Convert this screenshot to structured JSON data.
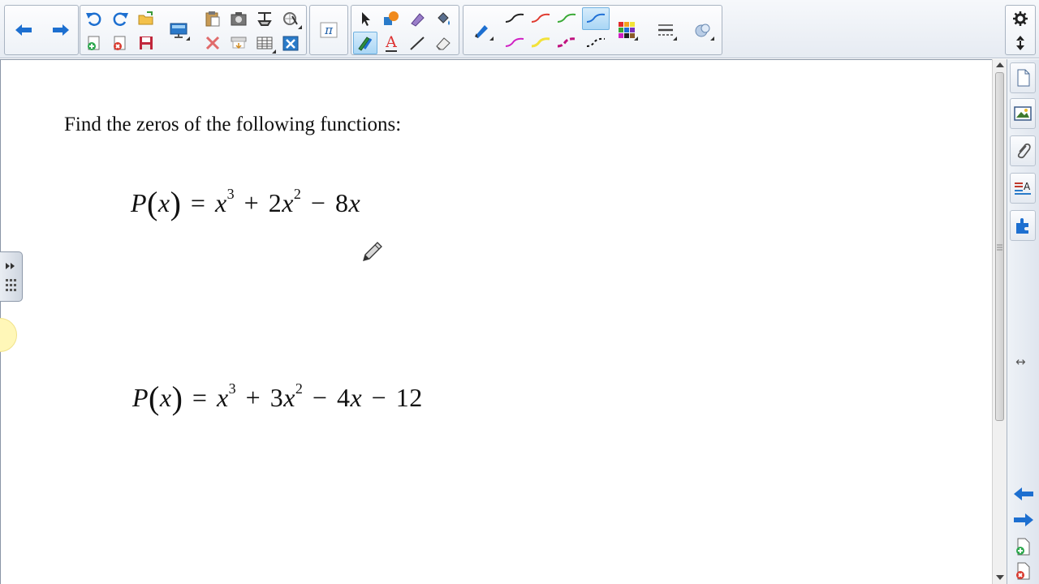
{
  "toolbar": {
    "icons": [
      "back-arrow-icon",
      "forward-arrow-icon",
      "undo-icon",
      "redo-icon",
      "open-folder-icon",
      "new-page-icon",
      "delete-page-icon",
      "save-icon",
      "screen-shade-icon",
      "paste-icon",
      "capture-icon",
      "document-camera-icon",
      "measurement-tools-icon",
      "delete-icon",
      "show-hide-icon",
      "table-icon",
      "clear-page-icon",
      "math-tools-icon",
      "select-icon",
      "shapes-icon",
      "magic-pen-icon",
      "fill-icon",
      "pen-icon",
      "creative-pen-icon",
      "text-icon",
      "line-icon",
      "eraser-icon",
      "properties-icon",
      "color-palette-icon",
      "line-style-icon",
      "more-tools-icon"
    ],
    "math_label": "π",
    "text_label": "A"
  },
  "pen_colors": {
    "black": "#222222",
    "red": "#e03a2f",
    "green": "#39a935",
    "blue": "#1f6fd6",
    "magenta": "#d01fc3",
    "yellow": "#f2e23a",
    "violet": "#c0127e",
    "dashed": "#111111"
  },
  "canvas": {
    "prompt": "Find the zeros of the following functions:",
    "eq1": {
      "lhs_fn": "P",
      "lhs_var": "x",
      "t1": "x",
      "t1_exp": "3",
      "t2_coef": "2",
      "t2": "x",
      "t2_exp": "2",
      "t3_coef": "8",
      "t3": "x"
    },
    "eq2": {
      "lhs_fn": "P",
      "lhs_var": "x",
      "t1": "x",
      "t1_exp": "3",
      "t2_coef": "3",
      "t2": "x",
      "t2_exp": "2",
      "t3_coef": "4",
      "t3": "x",
      "t4": "12"
    },
    "symbols": {
      "eq": "=",
      "plus": "+",
      "minus": "−",
      "lparen": "(",
      "rparen": ")"
    }
  },
  "sidebar": {
    "tabs": [
      "page-sorter-icon",
      "gallery-icon",
      "attachments-icon",
      "properties-tab-icon",
      "add-ons-icon"
    ],
    "resize_glyph": "↔"
  }
}
